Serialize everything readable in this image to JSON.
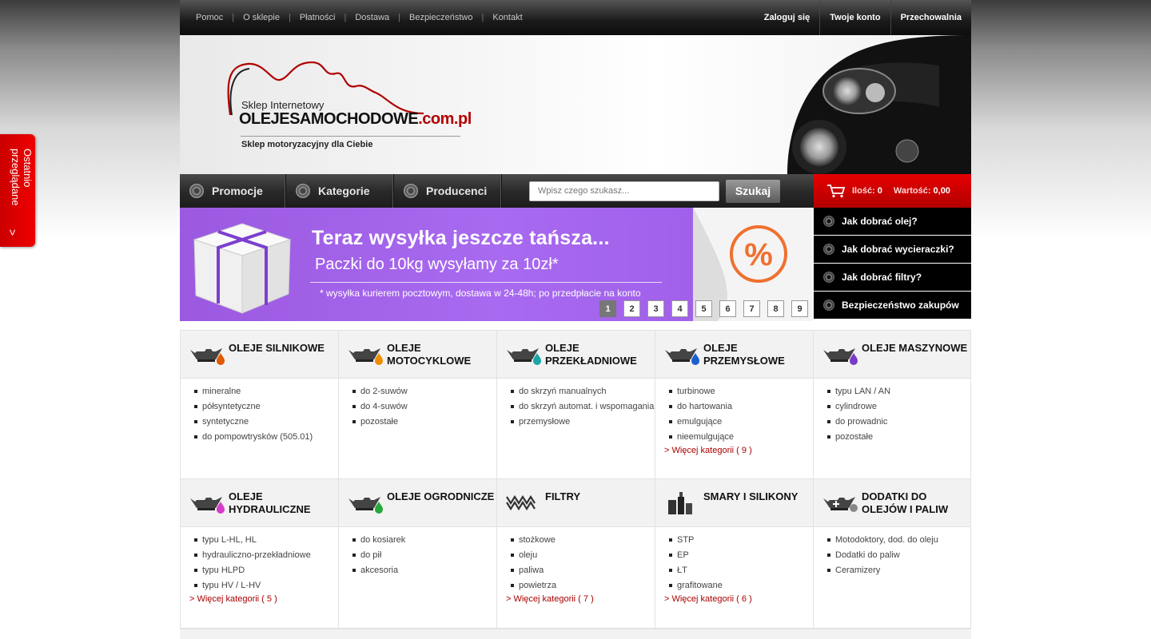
{
  "topnav": {
    "links": [
      "Pomoc",
      "O sklepie",
      "Płatności",
      "Dostawa",
      "Bezpieczeństwo",
      "Kontakt"
    ],
    "account": [
      "Zaloguj się",
      "Twoje konto",
      "Przechowalnia"
    ]
  },
  "header": {
    "logo_small": "Sklep Internetowy",
    "logo_brand_a": "OLEJE",
    "logo_brand_b": "SAMOCHODOWE",
    "logo_brand_c": ".com.pl",
    "tagline": "Sklep motoryzacyjny dla Ciebie"
  },
  "menu": {
    "tabs": [
      "Promocje",
      "Kategorie",
      "Producenci"
    ],
    "search_placeholder": "Wpisz czego szukasz...",
    "search_button": "Szukaj",
    "cart_qty_label": "Ilość:",
    "cart_qty": "0",
    "cart_value_label": "Wartość:",
    "cart_value": "0,00"
  },
  "banner": {
    "title": "Teraz wysyłka jeszcze tańsza...",
    "subtitle": "Paczki do 10kg wysyłamy za 10zł*",
    "note": "* wysyłka kurierem pocztowym, dostawa w 24-48h; po przedpłacie na konto",
    "badge": "%",
    "pages": [
      "1",
      "2",
      "3",
      "4",
      "5",
      "6",
      "7",
      "8",
      "9"
    ],
    "active_page": "1"
  },
  "sidemenu": [
    "Jak dobrać olej?",
    "Jak dobrać wycieraczki?",
    "Jak dobrać filtry?",
    "Bezpieczeństwo zakupów"
  ],
  "sidetab": {
    "label": "Ostatnio przeglądane",
    "arrow": ">"
  },
  "colors": {
    "accent": "#d40000",
    "banner": "#a065ea"
  },
  "categories": [
    {
      "title": "OLEJE SILNIKOWE",
      "icon": "oil-can-icon",
      "drop": "#e05a00",
      "items": [
        "mineralne",
        "półsyntetyczne",
        "syntetyczne",
        "do pompowtrysków (505.01)"
      ],
      "more": ""
    },
    {
      "title": "OLEJE MOTOCYKLOWE",
      "icon": "oil-can-icon",
      "drop": "#f08c00",
      "items": [
        "do 2-suwów",
        "do 4-suwów",
        "pozostałe"
      ],
      "more": ""
    },
    {
      "title": "OLEJE PRZEKŁADNIOWE",
      "icon": "oil-can-icon",
      "drop": "#1aa6a6",
      "items": [
        "do skrzyń manualnych",
        "do skrzyń automat. i wspomagania",
        "przemysłowe"
      ],
      "more": ""
    },
    {
      "title": "OLEJE PRZEMYSŁOWE",
      "icon": "oil-can-icon",
      "drop": "#1a5ed0",
      "items": [
        "turbinowe",
        "do hartowania",
        "emulgujące",
        "nieemulgujące"
      ],
      "more": "> Więcej kategorii ( 9 )"
    },
    {
      "title": "OLEJE MASZYNOWE",
      "icon": "oil-can-icon",
      "drop": "#7a3cc8",
      "items": [
        "typu LAN / AN",
        "cylindrowe",
        "do prowadnic",
        "pozostałe"
      ],
      "more": ""
    },
    {
      "title": "OLEJE HYDRAULICZNE",
      "icon": "oil-can-icon",
      "drop": "#d63cc8",
      "items": [
        "typu L-HL, HL",
        "hydrauliczno-przekładniowe",
        "typu HLPD",
        "typu HV / L-HV"
      ],
      "more": "> Więcej kategorii ( 5 )"
    },
    {
      "title": "OLEJE OGRODNICZE",
      "icon": "oil-can-icon",
      "drop": "#2aa83a",
      "items": [
        "do kosiarek",
        "do pił",
        "akcesoria"
      ],
      "more": ""
    },
    {
      "title": "FILTRY",
      "icon": "filter-icon",
      "drop": "",
      "items": [
        "stożkowe",
        "oleju",
        "paliwa",
        "powietrza"
      ],
      "more": "> Więcej kategorii ( 7 )"
    },
    {
      "title": "SMARY I SILIKONY",
      "icon": "grease-icon",
      "drop": "",
      "items": [
        "STP",
        "EP",
        "ŁT",
        "grafitowane"
      ],
      "more": "> Więcej kategorii ( 6 )"
    },
    {
      "title": "DODATKI DO OLEJÓW I PALIW",
      "icon": "additive-icon",
      "drop": "",
      "items": [
        "Motodoktory, dod. do oleju",
        "Dodatki do paliw",
        "Ceramizery"
      ],
      "more": ""
    }
  ]
}
